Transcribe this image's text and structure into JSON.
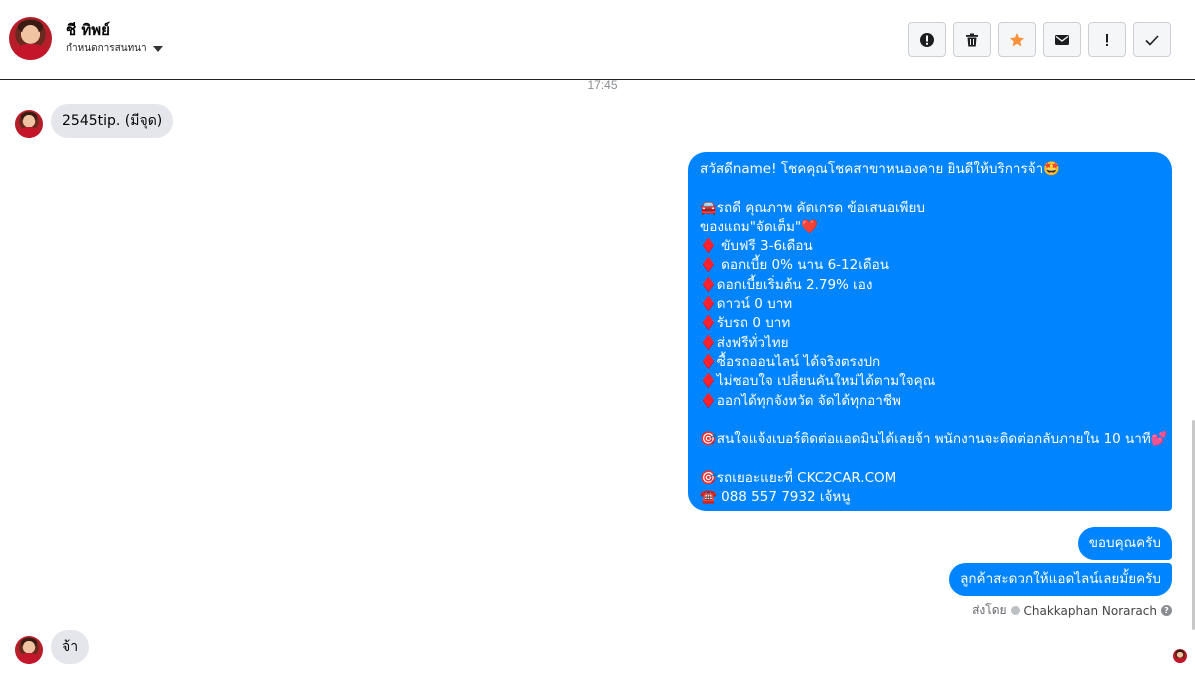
{
  "header": {
    "contact_name": "ชี ทิพย์",
    "assign_label": "กำหนดการสนทนา",
    "actions": [
      {
        "name": "report-spam-button",
        "icon": "alert-circle-icon"
      },
      {
        "name": "delete-button",
        "icon": "trash-icon"
      },
      {
        "name": "star-button",
        "icon": "star-icon",
        "color": "#f7923b"
      },
      {
        "name": "mark-unread-button",
        "icon": "envelope-icon"
      },
      {
        "name": "important-button",
        "icon": "exclamation-icon"
      },
      {
        "name": "mark-done-button",
        "icon": "check-icon"
      }
    ]
  },
  "conversation": {
    "timestamp": "17:45",
    "incoming_1": "2545tip. (มีจุด)",
    "outgoing_main": [
      "สวัสดีname! โชคคุณโชคสาขาหนองคาย ยินดีให้บริการจ้า🤩",
      "",
      "🚘รถดี คุณภาพ คัดเกรด ข้อเสนอเพียบ",
      "ของแถม\"จัดเต็ม\"❤️",
      "♦️ ขับฟรี 3-6เดือน",
      "♦️ ดอกเบี้ย 0% นาน 6-12เดือน",
      "♦️ดอกเบี้ยเริ่มต้น 2.79% เอง",
      "♦️ดาวน์ 0 บาท",
      "♦️รับรถ 0 บาท",
      "♦️ส่งฟรีทั่วไทย",
      "♦️ซื้อรถออนไลน์ ได้จริงตรงปก",
      "♦️ไม่ชอบใจ เปลี่ยนคันใหม่ได้ตามใจคุณ",
      "♦️ออกได้ทุกจังหวัด จัดได้ทุกอาชีพ",
      "",
      "🎯สนใจแจ้งเบอร์ติดต่อแอดมินได้เลยจ้า พนักงานจะติดต่อกลับภายใน 10 นาที💕",
      "",
      "🎯รถเยอะแยะที่ CKC2CAR.COM",
      "☎️ 088 557 7932 เจ้หนู"
    ],
    "outgoing_2": "ขอบคุณครับ",
    "outgoing_3": "ลูกค้าสะดวกให้แอดไลน์เลยมั้ยครับ",
    "sent_by_label": "ส่งโดย",
    "sent_by_name": "Chakkaphan Norarach",
    "incoming_2": "จ้า"
  },
  "colors": {
    "outgoing_bubble": "#0084ff",
    "incoming_bubble": "#e4e6eb",
    "star": "#f7923b"
  }
}
